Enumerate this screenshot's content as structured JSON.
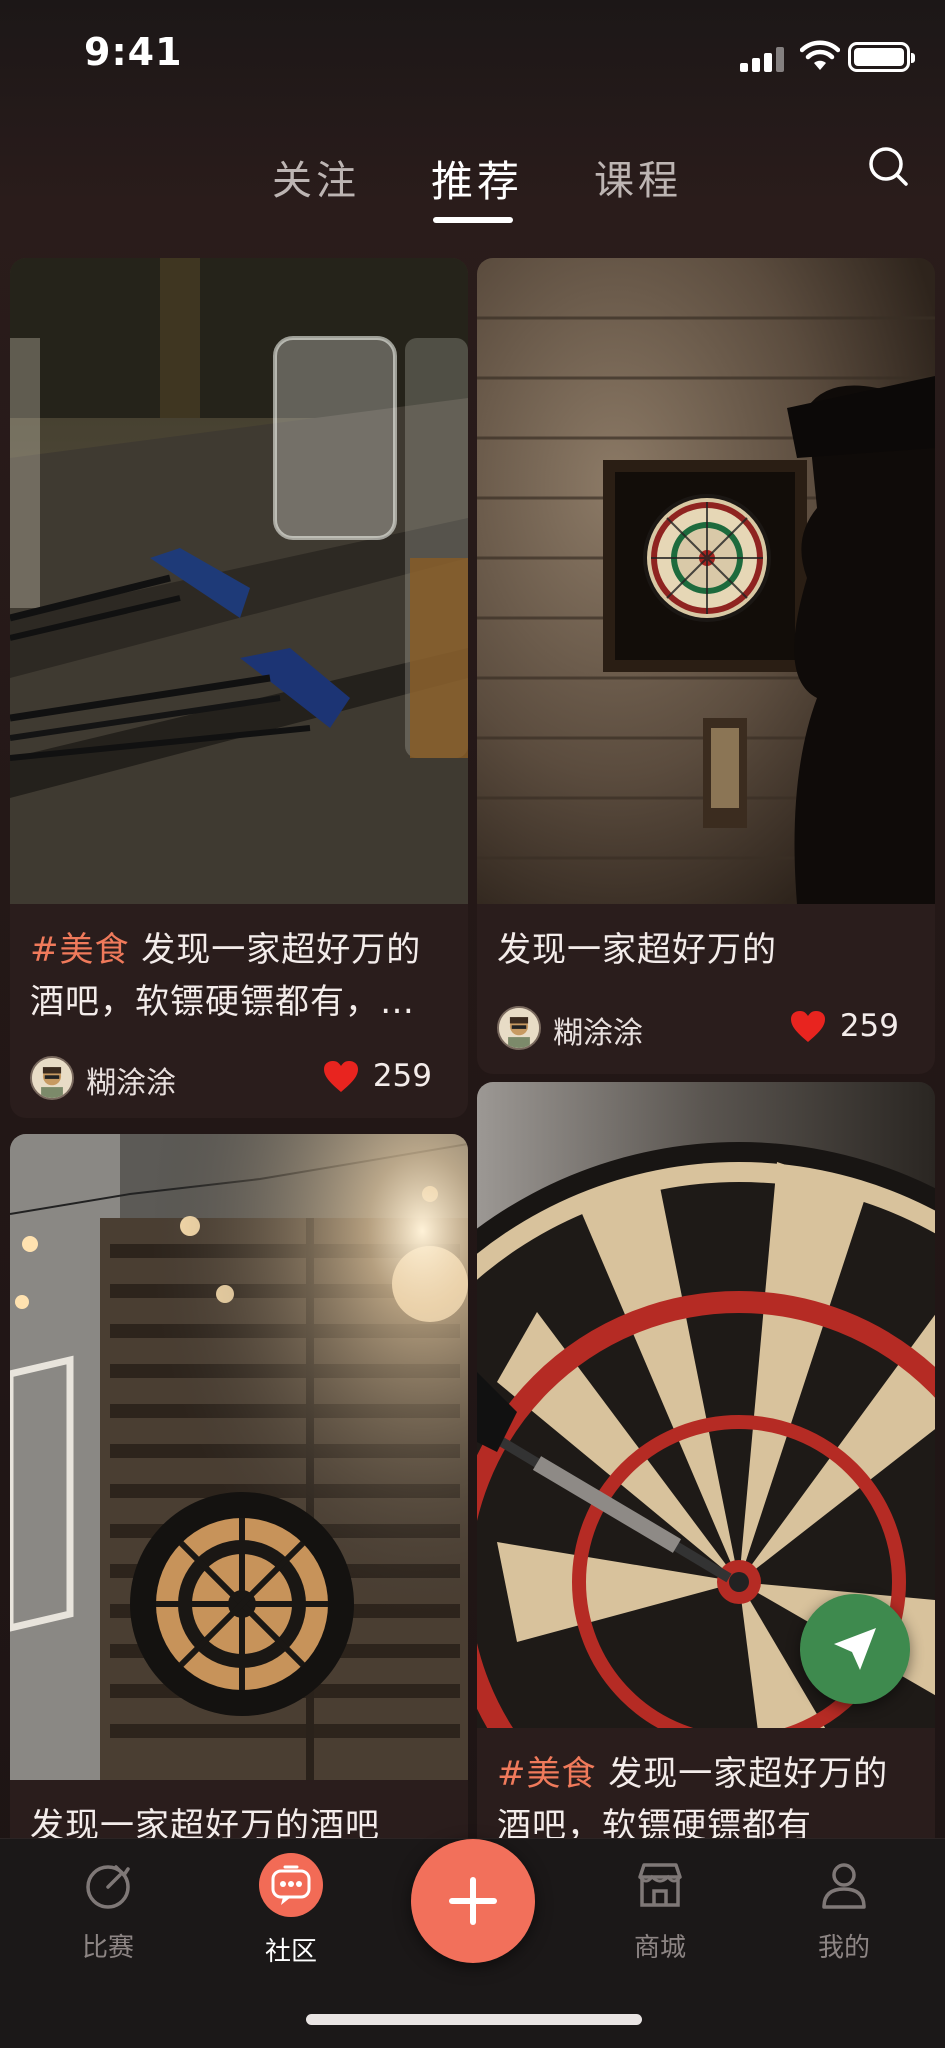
{
  "status_bar": {
    "time": "9:41"
  },
  "tabs": [
    {
      "label": "关注",
      "active": false
    },
    {
      "label": "推荐",
      "active": true
    },
    {
      "label": "课程",
      "active": false
    }
  ],
  "cards": [
    {
      "tag": "#美食",
      "text_line1": " 发现一家超好万的",
      "text_line2": "酒吧，软镖硬镖都有，…",
      "author": "糊涂涂",
      "likes": "259",
      "image_icon": "darts-on-table-photo"
    },
    {
      "tag": "",
      "text_line1": "发现一家超好万的",
      "text_line2": "",
      "author": "糊涂涂",
      "likes": "259",
      "image_icon": "man-dartboard-photo"
    },
    {
      "tag": "",
      "text_line1": "发现一家超好万的酒吧",
      "text_line2": "",
      "author": "",
      "likes": "",
      "image_icon": "wall-dartboard-photo"
    },
    {
      "tag": "#美食",
      "text_line1": " 发现一家超好万的",
      "text_line2": "酒吧，软镖硬镖都有",
      "author": "",
      "likes": "",
      "image_icon": "dartboard-closeup-photo"
    }
  ],
  "bottom_nav": [
    {
      "label": "比赛",
      "icon": "trophy-icon",
      "active": false
    },
    {
      "label": "社区",
      "icon": "chat-icon",
      "active": true
    },
    {
      "label": "",
      "icon": "plus-icon",
      "active": false
    },
    {
      "label": "商城",
      "icon": "store-icon",
      "active": false
    },
    {
      "label": "我的",
      "icon": "user-icon",
      "active": false
    }
  ],
  "colors": {
    "accent": "#f2705b",
    "tag": "#f07a5b",
    "share_button": "#3e8a4e",
    "like_heart": "#e8241f"
  }
}
